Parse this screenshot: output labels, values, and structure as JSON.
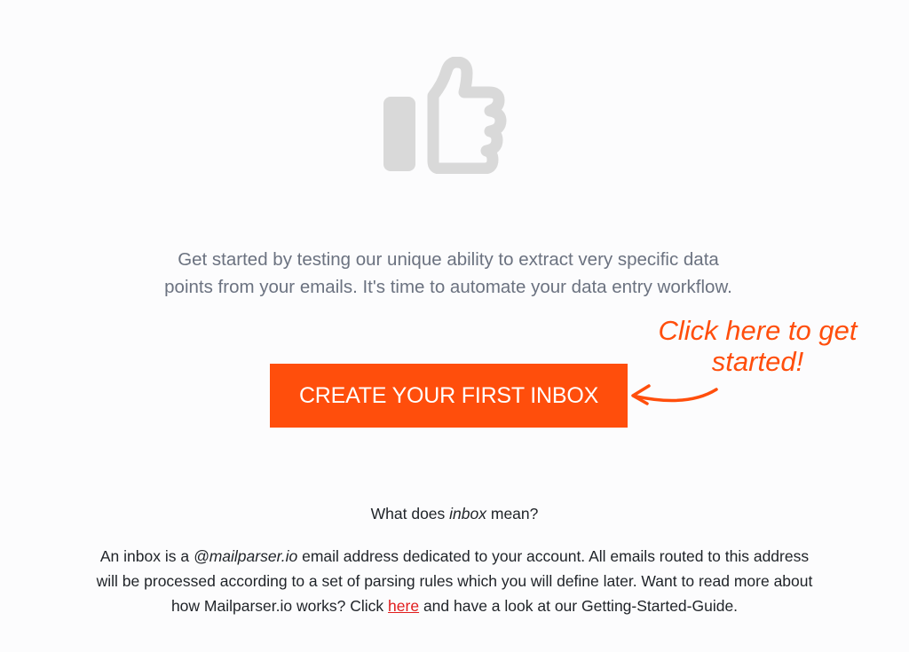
{
  "hero": {
    "icon": "thumbs-up-icon",
    "icon_color": "#d9d9d9"
  },
  "intro": {
    "line1": "Get started by testing our unique ability to extract very specific data",
    "line2": "points from your emails. It's time to automate your data entry workflow."
  },
  "cta": {
    "label": "CREATE YOUR FIRST INBOX",
    "color": "#ff4e0c"
  },
  "annotation": {
    "line1": "Click here to get",
    "line2": "started!"
  },
  "faq": {
    "question_prefix": "What does ",
    "question_term": "inbox",
    "question_suffix": " mean?",
    "p1": "An inbox is a ",
    "p_domain": "@mailparser.io",
    "p2": " email address dedicated to your account. All emails routed to this address",
    "p3": "will be processed according to a set of parsing rules which you will define later. Want to read more about",
    "p4": "how Mailparser.io works? Click ",
    "link_label": "here",
    "p5": " and have a look at our Getting-Started-Guide."
  }
}
